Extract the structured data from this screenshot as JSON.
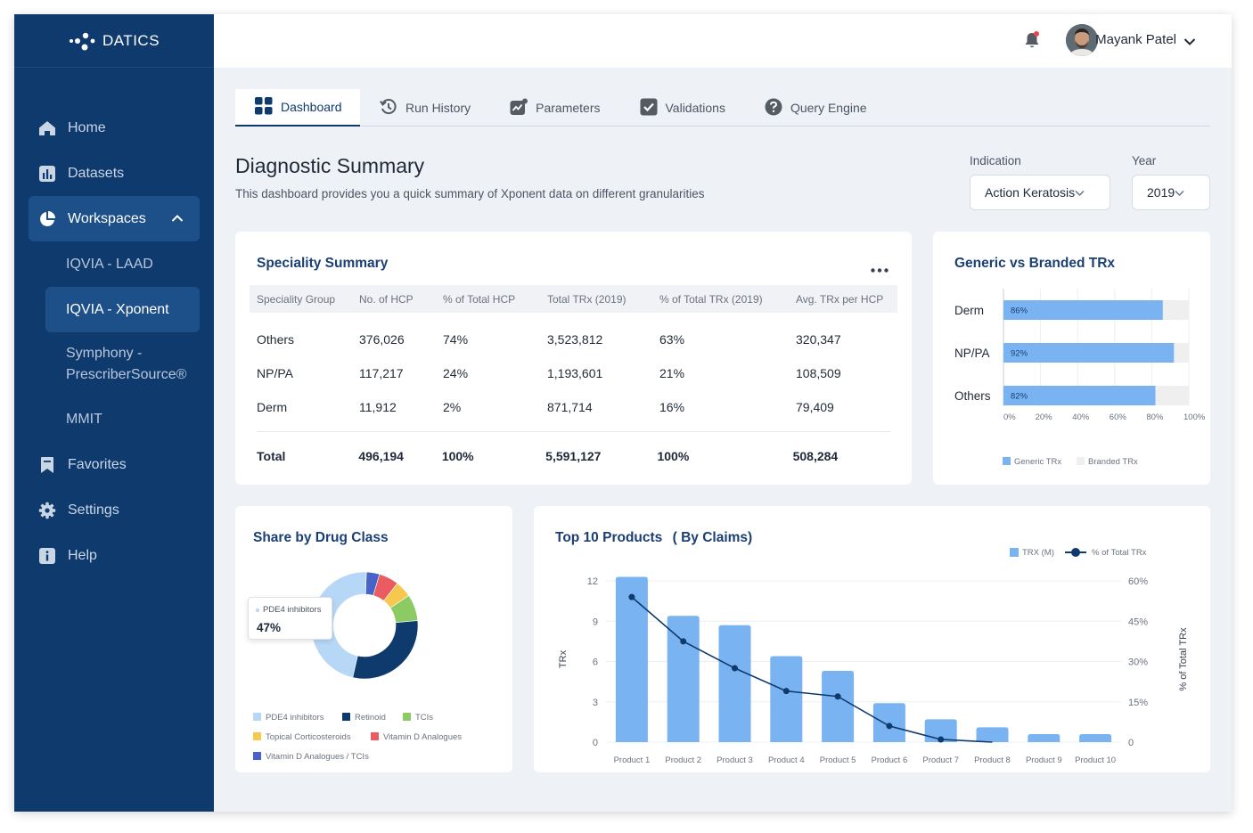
{
  "brand": {
    "name": "DATICS"
  },
  "sidebar": {
    "items": [
      {
        "label": "Home",
        "icon": "home-icon"
      },
      {
        "label": "Datasets",
        "icon": "bar-chart-icon"
      },
      {
        "label": "Workspaces",
        "icon": "pie-chart-icon",
        "expanded": true
      },
      {
        "label": "Favorites",
        "icon": "bookmark-icon"
      },
      {
        "label": "Settings",
        "icon": "gear-icon"
      },
      {
        "label": "Help",
        "icon": "info-icon"
      }
    ],
    "workspaces": [
      {
        "label": "IQVIA - LAAD"
      },
      {
        "label": "IQVIA - Xponent",
        "active": true
      },
      {
        "label_line1": "Symphony -",
        "label_line2": "PrescriberSource®"
      },
      {
        "label": "MMIT"
      }
    ]
  },
  "header": {
    "user_name": "Mayank Patel",
    "notification_dot": true
  },
  "tabs": [
    {
      "label": "Dashboard",
      "icon": "grid-icon",
      "active": true
    },
    {
      "label": "Run History",
      "icon": "history-icon"
    },
    {
      "label": "Parameters",
      "icon": "trend-icon"
    },
    {
      "label": "Validations",
      "icon": "checkbox-icon"
    },
    {
      "label": "Query Engine",
      "icon": "question-icon"
    }
  ],
  "page": {
    "title": "Diagnostic Summary",
    "subtitle": "This dashboard provides you a quick summary of Xponent data on different granularities"
  },
  "filters": {
    "indication_label": "Indication",
    "indication_value": "Action Keratosis",
    "year_label": "Year",
    "year_value": "2019"
  },
  "speciality": {
    "title": "Speciality Summary",
    "columns": [
      "Speciality Group",
      "No. of HCP",
      "% of Total HCP",
      "Total TRx (2019)",
      "% of Total TRx (2019)",
      "Avg. TRx per HCP"
    ],
    "rows": [
      [
        "Others",
        "376,026",
        "74%",
        "3,523,812",
        "63%",
        "320,347"
      ],
      [
        "NP/PA",
        "117,217",
        "24%",
        "1,193,601",
        "21%",
        "108,509"
      ],
      [
        "Derm",
        "11,912",
        "2%",
        "871,714",
        "16%",
        "79,409"
      ]
    ],
    "total": [
      "Total",
      "496,194",
      "100%",
      "5,591,127",
      "100%",
      "508,284"
    ]
  },
  "chart_data": [
    {
      "type": "bar",
      "orientation": "horizontal",
      "stacked": true,
      "title": "Generic vs Branded TRx",
      "categories": [
        "Derm",
        "NP/PA",
        "Others"
      ],
      "series": [
        {
          "name": "Generic TRx",
          "values": [
            86,
            92,
            82
          ],
          "labels": [
            "86%",
            "92%",
            "82%"
          ],
          "color": "#79b3f1"
        },
        {
          "name": "Branded TRx",
          "values": [
            14,
            8,
            18
          ],
          "color": "#efefef"
        }
      ],
      "xticks": [
        "0%",
        "20%",
        "40%",
        "60%",
        "80%",
        "100%"
      ],
      "xlim": [
        0,
        100
      ],
      "legend": "bottom"
    },
    {
      "type": "pie",
      "donut": true,
      "title": "Share by Drug Class",
      "slices": [
        {
          "name": "PDE4 inhibitors",
          "value": 47,
          "color": "#b7d7f7"
        },
        {
          "name": "Retinoid",
          "value": 30,
          "color": "#0f3a6e"
        },
        {
          "name": "TCIs",
          "value": 8,
          "color": "#8ccb64"
        },
        {
          "name": "Topical Corticosteroids",
          "value": 5,
          "color": "#f7c850"
        },
        {
          "name": "Vitamin D Analogues",
          "value": 6,
          "color": "#ea5b62"
        },
        {
          "name": "Vitamin D Analogues / TCIs",
          "value": 4,
          "color": "#4863c7"
        }
      ],
      "tooltip": {
        "label": "PDE4 inhibitors",
        "value": "47%"
      },
      "legend": "bottom"
    },
    {
      "type": "bar",
      "title": "Top 10 Products",
      "subtitle": "( By Claims)",
      "categories": [
        "Product 1",
        "Product 2",
        "Product 3",
        "Product 4",
        "Product 5",
        "Product 6",
        "Product 7",
        "Product 8",
        "Product 9",
        "Product 10"
      ],
      "series": [
        {
          "name": "TRX (M)",
          "type": "bar",
          "axis": "left",
          "values": [
            12.3,
            9.4,
            8.7,
            6.4,
            5.3,
            2.9,
            1.7,
            1.1,
            0.6,
            0.6
          ],
          "color": "#79b3f1"
        },
        {
          "name": "% of Total TRx",
          "type": "line",
          "axis": "right",
          "values": [
            54,
            37.5,
            27.5,
            19,
            17,
            6,
            1,
            0
          ],
          "color": "#0f3a6e"
        }
      ],
      "ylabel": "TRx",
      "y2label": "% of Total TRx",
      "yticks": [
        "0",
        "3",
        "6",
        "9",
        "12"
      ],
      "y2ticks": [
        "0",
        "15%",
        "30%",
        "45%",
        "60%"
      ],
      "ylim": [
        0,
        12
      ],
      "y2lim": [
        0,
        60
      ],
      "grid": true,
      "legend": "top-right"
    }
  ]
}
